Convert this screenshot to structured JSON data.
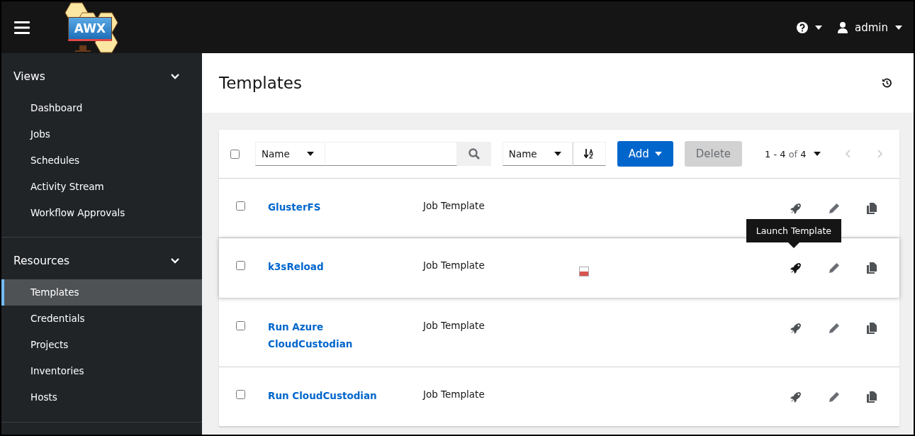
{
  "header": {
    "logo_text": "AWX",
    "user": "admin"
  },
  "sidebar": {
    "groups": [
      {
        "title": "Views",
        "expanded": true,
        "items": [
          {
            "label": "Dashboard",
            "selected": false
          },
          {
            "label": "Jobs",
            "selected": false
          },
          {
            "label": "Schedules",
            "selected": false
          },
          {
            "label": "Activity Stream",
            "selected": false
          },
          {
            "label": "Workflow Approvals",
            "selected": false
          }
        ]
      },
      {
        "title": "Resources",
        "expanded": true,
        "items": [
          {
            "label": "Templates",
            "selected": true
          },
          {
            "label": "Credentials",
            "selected": false
          },
          {
            "label": "Projects",
            "selected": false
          },
          {
            "label": "Inventories",
            "selected": false
          },
          {
            "label": "Hosts",
            "selected": false
          }
        ]
      }
    ]
  },
  "page": {
    "title": "Templates"
  },
  "toolbar": {
    "select_all_checked": false,
    "search_key": "Name",
    "sort_key": "Name",
    "add_label": "Add",
    "delete_label": "Delete",
    "delete_disabled": true,
    "pagination": {
      "range": "1 - 4",
      "of": "of",
      "total": "4"
    }
  },
  "rows": [
    {
      "name": "GlusterFS",
      "type": "Job Template",
      "checked": false,
      "hovered": false
    },
    {
      "name": "k3sReload",
      "type": "Job Template",
      "checked": false,
      "hovered": true,
      "tooltip": "Launch Template",
      "recent_jobs": [
        {
          "color": "#d9534f"
        }
      ]
    },
    {
      "name": "Run Azure CloudCustodian",
      "type": "Job Template",
      "checked": false,
      "hovered": false
    },
    {
      "name": "Run CloudCustodian",
      "type": "Job Template",
      "checked": false,
      "hovered": false
    }
  ]
}
